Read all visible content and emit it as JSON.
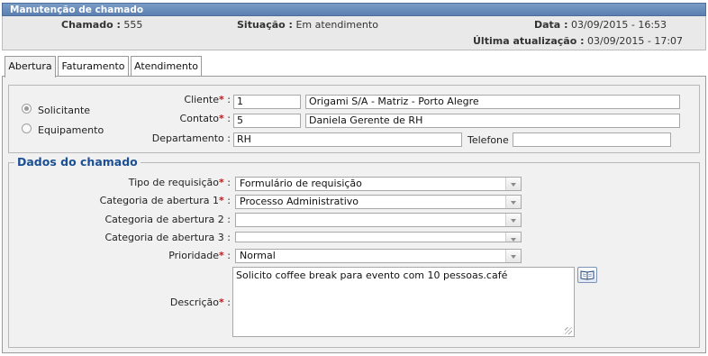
{
  "window": {
    "title": "Manutenção de chamado"
  },
  "info": {
    "chamado_label": "Chamado :",
    "chamado_value": "555",
    "situacao_label": "Situação :",
    "situacao_value": "Em atendimento",
    "data_label": "Data :",
    "data_value": "03/09/2015 - 16:53",
    "ultima_label": "Última atualização :",
    "ultima_value": "03/09/2015 - 17:07"
  },
  "tabs": [
    {
      "label": "Abertura",
      "active": true
    },
    {
      "label": "Faturamento",
      "active": false
    },
    {
      "label": "Atendimento",
      "active": false
    }
  ],
  "requester": {
    "radio_solicitante": "Solicitante",
    "radio_equipamento": "Equipamento",
    "selected": "Solicitante",
    "cliente_label": "Cliente",
    "cliente_code": "1",
    "cliente_name": "Origami S/A - Matriz - Porto Alegre",
    "contato_label": "Contato",
    "contato_code": "5",
    "contato_name": "Daniela Gerente de RH",
    "departamento_label": "Departamento :",
    "departamento_value": "RH",
    "telefone_label": "Telefone :",
    "telefone_value": "",
    "required_mark": "*",
    "colon": ":"
  },
  "ticket": {
    "legend": "Dados do chamado",
    "tipo_label": "Tipo de requisição",
    "tipo_value": "Formulário de requisição",
    "cat1_label": "Categoria de abertura 1",
    "cat1_value": "Processo Administrativo",
    "cat2_label": "Categoria de abertura 2 :",
    "cat2_value": "",
    "cat3_label": "Categoria de abertura 3 :",
    "cat3_value": "",
    "prioridade_label": "Prioridade",
    "prioridade_value": "Normal",
    "descricao_label": "Descrição",
    "descricao_value": "Solicito coffee break para evento com 10 pessoas.café"
  },
  "icons": {
    "book": "book-icon",
    "dropdown": "chevron-down-icon",
    "resize": "resize-grip-icon"
  },
  "colors": {
    "title_bar": "#6a8dbb",
    "legend": "#1c4f93",
    "required": "#cc1111"
  }
}
